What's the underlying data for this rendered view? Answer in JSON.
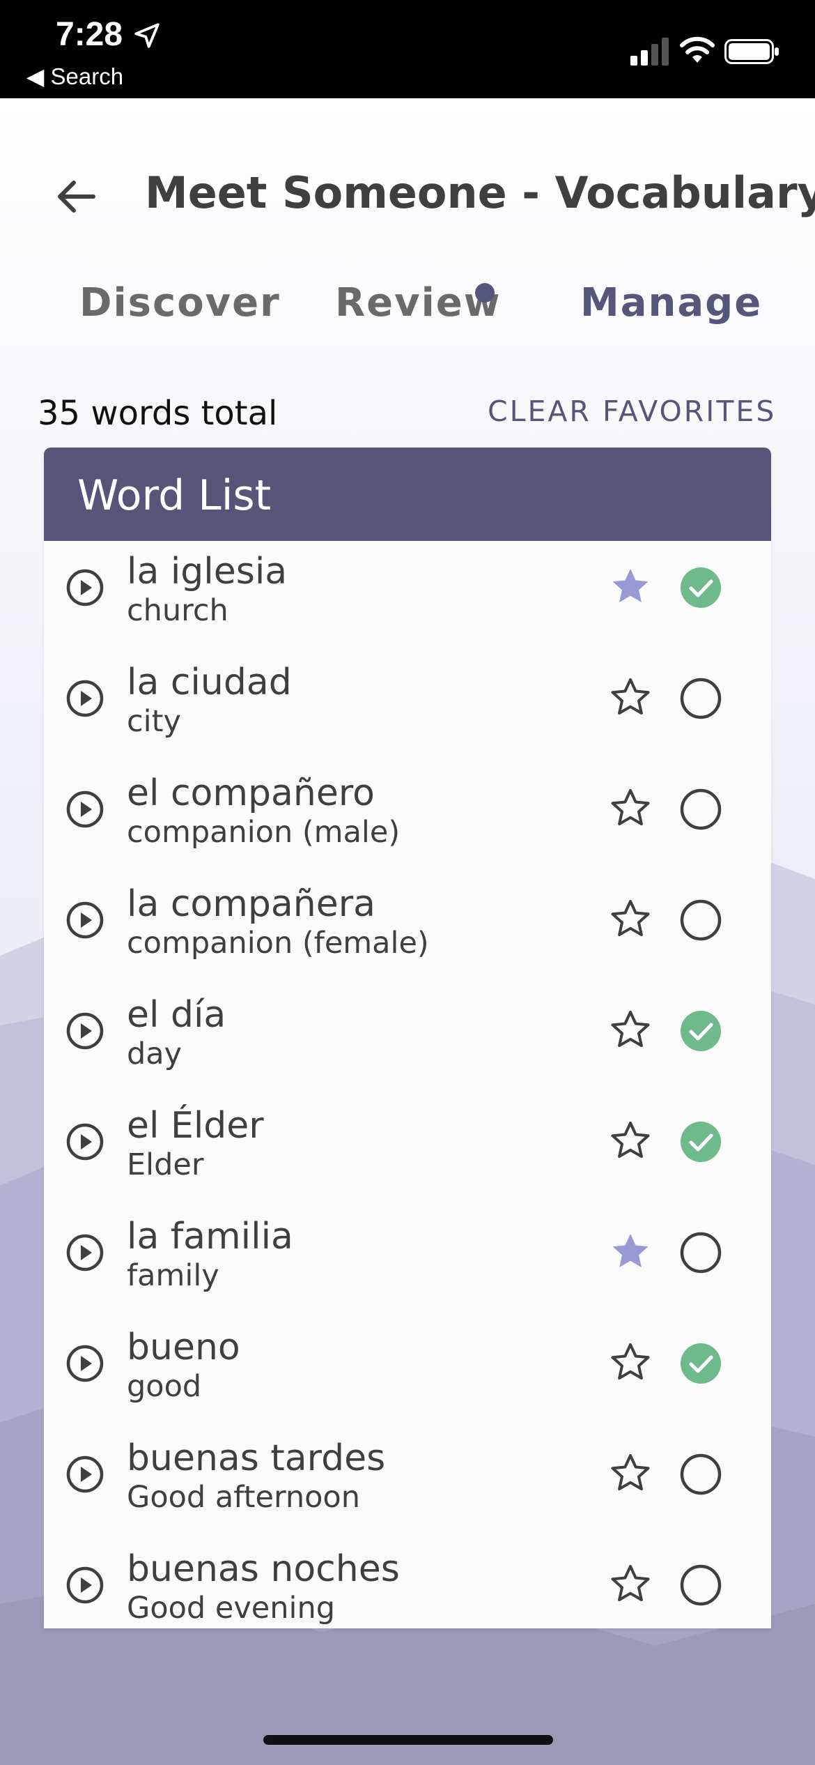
{
  "status_bar": {
    "time": "7:28",
    "back_label": "◀ Search"
  },
  "header": {
    "title": "Meet Someone - Vocabulary"
  },
  "tabs": [
    {
      "label": "Discover",
      "active": false
    },
    {
      "label": "Review",
      "active": false,
      "has_dot": true
    },
    {
      "label": "Manage",
      "active": true
    }
  ],
  "summary": {
    "words_total": "35 words total",
    "clear_favorites": "CLEAR FAVORITES"
  },
  "word_list": {
    "title": "Word List",
    "items": [
      {
        "word": "la iglesia",
        "translation": "church",
        "favorite": true,
        "learned": true
      },
      {
        "word": "la ciudad",
        "translation": "city",
        "favorite": false,
        "learned": false
      },
      {
        "word": "el compañero",
        "translation": "companion (male)",
        "favorite": false,
        "learned": false
      },
      {
        "word": "la compañera",
        "translation": "companion (female)",
        "favorite": false,
        "learned": false
      },
      {
        "word": "el día",
        "translation": "day",
        "favorite": false,
        "learned": true
      },
      {
        "word": "el Élder",
        "translation": "Elder",
        "favorite": false,
        "learned": true
      },
      {
        "word": "la familia",
        "translation": "family",
        "favorite": true,
        "learned": false
      },
      {
        "word": "bueno",
        "translation": "good",
        "favorite": false,
        "learned": true
      },
      {
        "word": "buenas tardes",
        "translation": "Good afternoon",
        "favorite": false,
        "learned": false
      },
      {
        "word": "buenas noches",
        "translation": "Good evening",
        "favorite": false,
        "learned": false
      }
    ]
  },
  "colors": {
    "accent": "#565578",
    "favorite_star": "#9b98d6",
    "learned_check": "#6fba8b",
    "text": "#3f3f3f"
  }
}
